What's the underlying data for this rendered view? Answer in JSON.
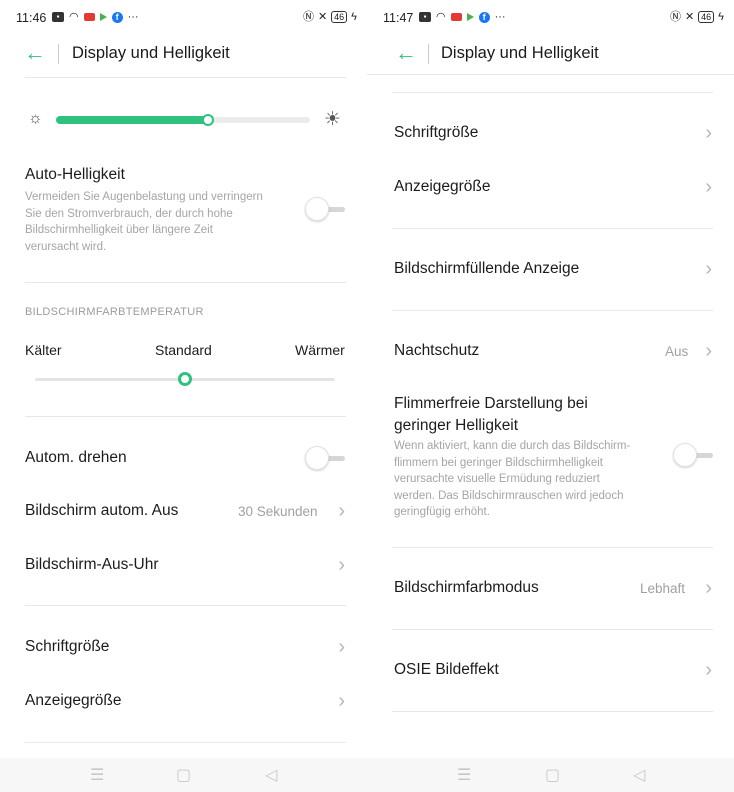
{
  "left": {
    "status": {
      "time": "11:46",
      "battery": "46"
    },
    "title": "Display und Helligkeit",
    "brightness": {
      "level": 0.6
    },
    "auto_brightness": {
      "label": "Auto-Helligkeit",
      "desc": [
        "Vermeiden Sie Augenbelastung und verringern",
        "Sie den Stromverbrauch, der durch hohe",
        "Bildschirmhelligkeit über längere Zeit",
        "verursacht wird."
      ]
    },
    "color_temp": {
      "section": "BILDSCHIRMFARBTEMPERATUR",
      "cold": "Kälter",
      "standard": "Standard",
      "warm": "Wärmer",
      "level": 0.5
    },
    "rotate": "Autom. drehen",
    "screen_off": {
      "label": "Bildschirm autom. Aus",
      "value": "30 Sekunden"
    },
    "screen_off_clock": "Bildschirm-Aus-Uhr",
    "font_size": "Schriftgröße",
    "display_size": "Anzeigegröße"
  },
  "right": {
    "status": {
      "time": "11:47",
      "battery": "46"
    },
    "title": "Display und Helligkeit",
    "font_size": "Schriftgröße",
    "display_size": "Anzeigegröße",
    "fullscreen": "Bildschirmfüllende Anzeige",
    "night": {
      "label": "Nachtschutz",
      "value": "Aus"
    },
    "flicker": {
      "label1": "Flimmerfreie Darstellung bei",
      "label2": "geringer Helligkeit",
      "desc": [
        "Wenn aktiviert, kann die durch das Bildschirm-",
        "flimmern bei geringer Bildschirmhelligkeit",
        "verursachte visuelle Ermüdung reduziert",
        "werden. Das Bildschirmrauschen wird jedoch",
        "geringfügig erhöht."
      ]
    },
    "color_mode": {
      "label": "Bildschirmfarbmodus",
      "value": "Lebhaft"
    },
    "osie": "OSIE Bildeffekt"
  },
  "colors": {
    "accent": "#2ec27e",
    "divider": "#e8e8e8",
    "secondary": "#a0a0a0"
  },
  "icons": [
    "back-arrow-icon",
    "chevron-right-icon",
    "sun-small-icon",
    "sun-large-icon",
    "wifi-icon",
    "nfc-icon",
    "vibrate-icon",
    "battery-icon",
    "charging-icon"
  ]
}
